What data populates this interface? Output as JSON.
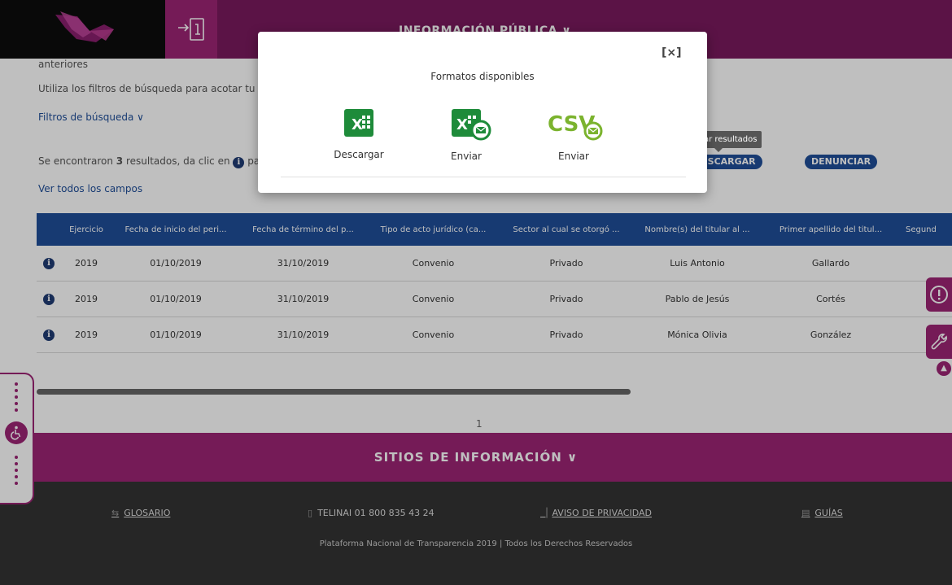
{
  "header": {
    "login_icon": "login-arrow-icon",
    "nav_label": "INFORMACIÓN PÚBLICA ∨"
  },
  "content": {
    "line_prev": "anteriores",
    "filter_hint": "Utiliza los filtros de búsqueda para acotar tu",
    "filters_label": "Filtros de búsqueda ∨",
    "results_prefix": "Se encontraron",
    "results_count": "3",
    "results_suffix": "resultados, da clic en",
    "results_tail": "pa",
    "view_all": "Ver todos los campos",
    "download_pill": "DESCARGAR",
    "denounce_pill": "DENUNCIAR"
  },
  "table": {
    "headers": [
      "Ejercicio",
      "Fecha de inicio del peri...",
      "Fecha de término del p...",
      "Tipo de acto jurídico (ca...",
      "Sector al cual se otorgó ...",
      "Nombre(s) del titular al ...",
      "Primer apellido del titul...",
      "Segund"
    ],
    "rows": [
      [
        "2019",
        "01/10/2019",
        "31/10/2019",
        "Convenio",
        "Privado",
        "Luis Antonio",
        "Gallardo"
      ],
      [
        "2019",
        "01/10/2019",
        "31/10/2019",
        "Convenio",
        "Privado",
        "Pablo de Jesús",
        "Cortés"
      ],
      [
        "2019",
        "01/10/2019",
        "31/10/2019",
        "Convenio",
        "Privado",
        "Mónica Olivia",
        "González"
      ]
    ]
  },
  "pager": {
    "page": "1"
  },
  "sitios": {
    "label": "SITIOS DE INFORMACIÓN ∨"
  },
  "footer": {
    "glosario": "GLOSARIO",
    "telinai": "TELINAI 01 800 835 43 24",
    "aviso": "AVISO DE PRIVACIDAD",
    "guias": "GUÍAS",
    "copyright": "Plataforma Nacional de Transparencia 2019 | Todos los Derechos Reservados"
  },
  "tooltip": {
    "text": "Descargar resultados"
  },
  "modal": {
    "close": "[×]",
    "title": "Formatos disponibles",
    "options": [
      {
        "icon": "excel-icon",
        "label": "Descargar"
      },
      {
        "icon": "excel-email-icon",
        "label": "Enviar"
      },
      {
        "icon": "csv-email-icon",
        "label": "Enviar",
        "badge": "CSV"
      }
    ]
  },
  "colors": {
    "brand": "#9c2474",
    "table_header": "#1f4e99",
    "excel_green": "#1e8b3a",
    "csv_green": "#7bb32e",
    "footer": "#333333"
  }
}
